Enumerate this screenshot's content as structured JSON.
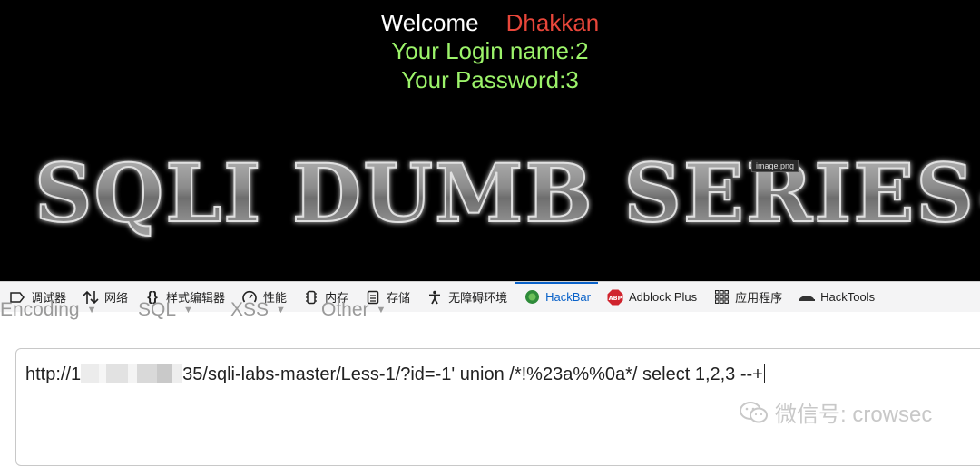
{
  "page": {
    "welcome_word": "Welcome",
    "user_name": "Dhakkan",
    "login_line": "Your Login name:2",
    "password_line": "Your Password:3",
    "banner_text": "SQLI DUMB SERIES-",
    "tooltip": "image.png"
  },
  "devtools": {
    "tabs": [
      {
        "label": "调试器",
        "icon": "debugger-icon"
      },
      {
        "label": "网络",
        "icon": "network-icon"
      },
      {
        "label": "样式编辑器",
        "icon": "style-editor-icon"
      },
      {
        "label": "性能",
        "icon": "performance-icon"
      },
      {
        "label": "内存",
        "icon": "memory-icon"
      },
      {
        "label": "存储",
        "icon": "storage-icon"
      },
      {
        "label": "无障碍环境",
        "icon": "accessibility-icon"
      },
      {
        "label": "HackBar",
        "icon": "hackbar-icon",
        "active": true
      },
      {
        "label": "Adblock Plus",
        "icon": "abp-icon"
      },
      {
        "label": "应用程序",
        "icon": "application-icon"
      },
      {
        "label": "HackTools",
        "icon": "hacktools-icon"
      }
    ]
  },
  "hackbar": {
    "menu": [
      "Encoding",
      "SQL",
      "XSS",
      "Other"
    ],
    "url_prefix": "http://1",
    "url_suffix": "35/sqli-labs-master/Less-1/?id=-1'  union /*!%23a%%0a*/ select 1,2,3 --+"
  },
  "watermark": {
    "text": "微信号: crowsec"
  },
  "colors": {
    "page_bg": "#000000",
    "welcome": "#ffffff",
    "user_name": "#e8463a",
    "info_text": "#9cf36a",
    "active_tab": "#0a62c9"
  }
}
